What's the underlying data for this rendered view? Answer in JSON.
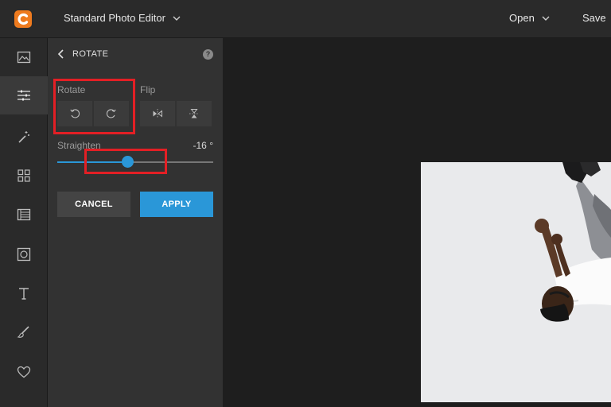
{
  "topbar": {
    "editor_title": "Standard Photo Editor",
    "open_label": "Open",
    "save_label": "Save",
    "logo_color": "#ee7b1f"
  },
  "rail": {
    "items": [
      {
        "icon": "image-icon"
      },
      {
        "icon": "sliders-icon",
        "active": true
      },
      {
        "icon": "magic-wand-icon"
      },
      {
        "icon": "grid-icon"
      },
      {
        "icon": "layout-icon"
      },
      {
        "icon": "frame-icon"
      },
      {
        "icon": "text-icon"
      },
      {
        "icon": "brush-icon"
      },
      {
        "icon": "heart-icon"
      }
    ]
  },
  "panel": {
    "title": "ROTATE",
    "help": "?",
    "rotate_label": "Rotate",
    "flip_label": "Flip",
    "straighten_label": "Straighten",
    "straighten_value": "-16 °",
    "straighten_level": 0.45,
    "cancel_label": "CANCEL",
    "apply_label": "APPLY"
  },
  "colors": {
    "accent": "#2a97d8",
    "highlight": "#e31f25",
    "panel_bg": "#323232",
    "canvas_bg": "#1e1e1e"
  }
}
